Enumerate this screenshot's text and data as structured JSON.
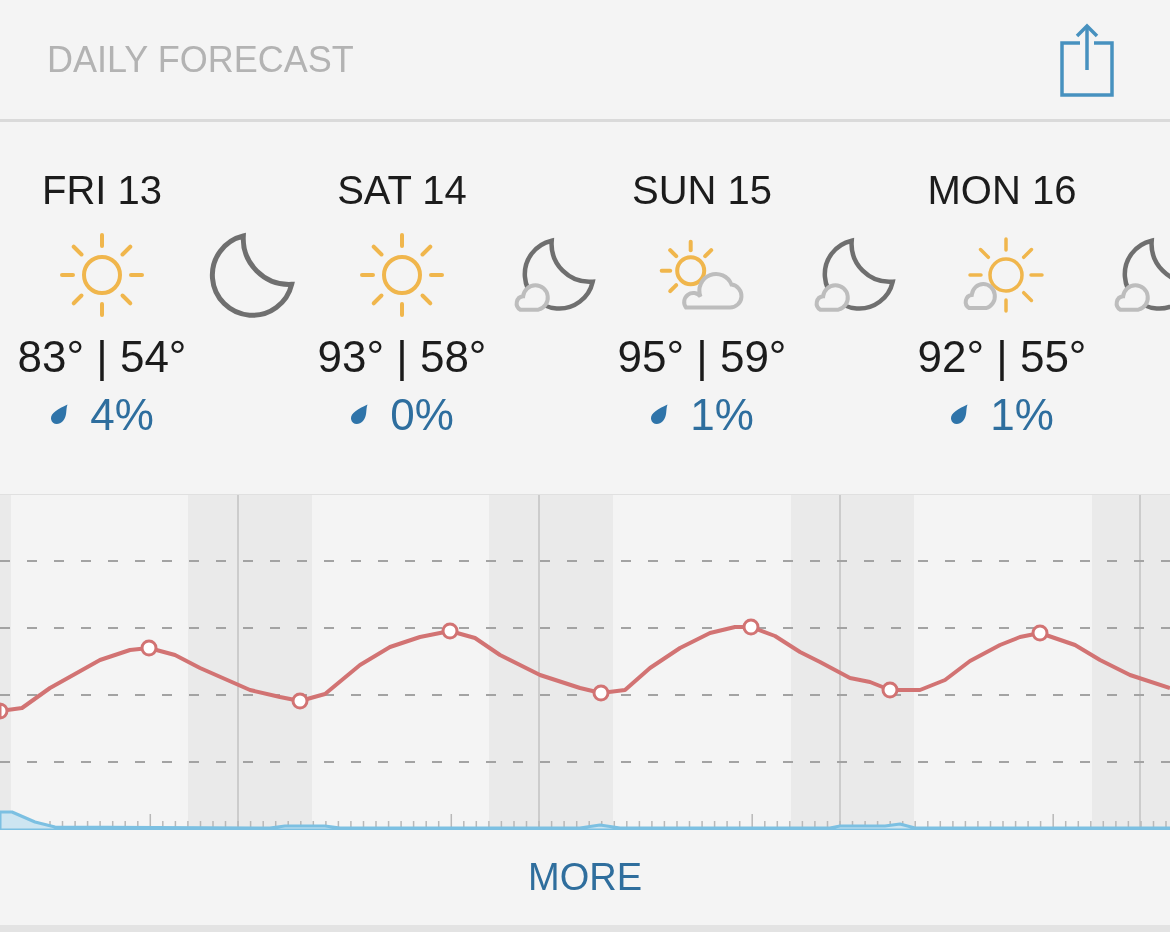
{
  "header": {
    "title": "DAILY FORECAST"
  },
  "days": [
    {
      "label": "FRI 13",
      "day_sky": {
        "kind": "sunny"
      },
      "night_sky": {
        "kind": "clear"
      },
      "temperatures": "83° | 54°",
      "precipitation": "4%"
    },
    {
      "label": "SAT 14",
      "day_sky": {
        "kind": "sunny"
      },
      "night_sky": {
        "kind": "partly-cloudy"
      },
      "temperatures": "93° | 58°",
      "precipitation": "0%"
    },
    {
      "label": "SUN 15",
      "day_sky": {
        "kind": "partly-cloudy"
      },
      "night_sky": {
        "kind": "partly-cloudy"
      },
      "temperatures": "95° | 59°",
      "precipitation": "1%"
    },
    {
      "label": "MON 16",
      "day_sky": {
        "kind": "mostly-sunny"
      },
      "night_sky": {
        "kind": "partly-cloudy"
      },
      "temperatures": "92° | 55°",
      "precipitation": "1%"
    }
  ],
  "more_button": {
    "label": "MORE"
  }
}
